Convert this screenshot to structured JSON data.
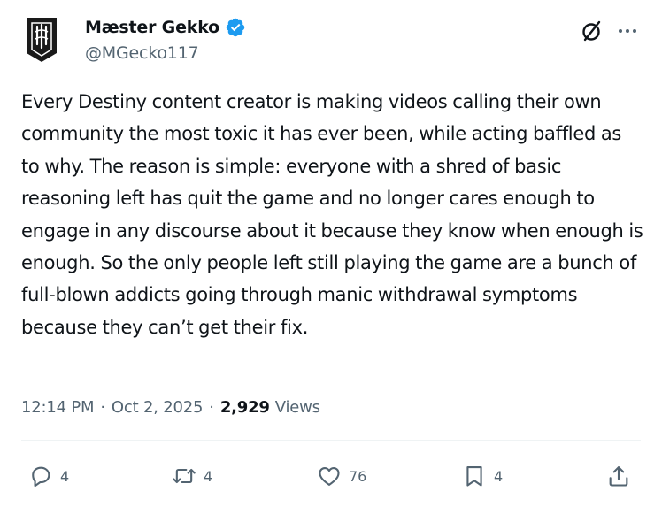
{
  "author": {
    "display_name": "Mæster Gekko",
    "handle": "@MGecko117",
    "verified": true,
    "avatar_icon": "black-banner-avatar"
  },
  "header_actions": {
    "grok_icon": "grok-slash-circle-icon",
    "more_icon": "more-horizontal-icon"
  },
  "tweet": {
    "text": "Every Destiny content creator is making videos calling their own community the most toxic it has ever been, while acting baffled as to why. The reason is simple: everyone with a shred of basic reasoning left has quit the game and no longer cares enough to engage in any discourse about it because they know when enough is enough. So the only people left still playing the game are a bunch of full-blown addicts going through manic withdrawal symptoms because they can’t get their fix."
  },
  "meta": {
    "time": "12:14 PM",
    "separator": "·",
    "date": "Oct 2, 2025",
    "views_count": "2,929",
    "views_label": "Views"
  },
  "actions": {
    "replies": "4",
    "reposts": "4",
    "likes": "76",
    "bookmarks": "4"
  },
  "colors": {
    "text_primary": "#0f1419",
    "text_secondary": "#536471",
    "verified_blue": "#1d9bf0",
    "divider": "#eff3f4"
  }
}
